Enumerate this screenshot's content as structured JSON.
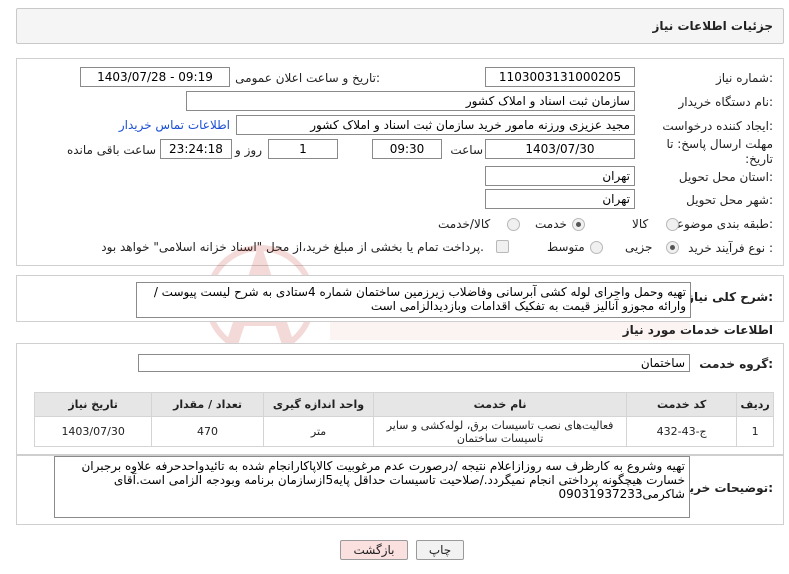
{
  "header": {
    "title": "جزئیات اطلاعات نیاز"
  },
  "form": {
    "need_number_label": "شماره نیاز:",
    "need_number": "1103003131000205",
    "announce_label": "تاریخ و ساعت اعلان عمومی:",
    "announce_value": "1403/07/28 - 09:19",
    "buyer_org_label": "نام دستگاه خریدار:",
    "buyer_org": "سازمان ثبت اسناد و املاک کشور",
    "creator_label": "ایجاد کننده درخواست:",
    "creator": "مجید عزیزی ورزنه مامور خرید سازمان ثبت اسناد و املاک کشور",
    "contact_link": "اطلاعات تماس خریدار",
    "deadline_label": "مهلت ارسال پاسخ: تا تاریخ:",
    "deadline_date": "1403/07/30",
    "time_label": "ساعت",
    "deadline_time": "09:30",
    "days_value": "1",
    "days_label": "روز و",
    "remaining_time": "23:24:18",
    "remaining_label": "ساعت باقی مانده",
    "province_label": "استان محل تحویل:",
    "province": "تهران",
    "city_label": "شهر محل تحویل:",
    "city": "تهران",
    "category_label": "طبقه بندی موضوعی:",
    "category_options": [
      "کالا",
      "خدمت",
      "کالا/خدمت"
    ],
    "category_selected": "خدمت",
    "process_label": "نوع فرآیند خرید :",
    "process_options": [
      "جزیی",
      "متوسط"
    ],
    "process_selected": "جزیی",
    "treasury_text": "پرداخت تمام یا بخشی از مبلغ خرید،از محل \"اسناد خزانه اسلامی\" خواهد بود."
  },
  "summary": {
    "label": "شرح کلی نیاز:",
    "text": "تهیه وحمل واجرای لوله کشی آبرسانی وفاضلاب زیرزمین ساختمان شماره 4ستادی به شرح لیست پیوست / وارائه مجوزو آنالیز قیمت به تفکیک اقدامات وبازدیدالزامی است"
  },
  "services": {
    "section_title": "اطلاعات خدمات مورد نیاز",
    "group_label": "گروه خدمت:",
    "group_value": "ساختمان",
    "columns": [
      "ردیف",
      "کد خدمت",
      "نام خدمت",
      "واحد اندازه گیری",
      "تعداد / مقدار",
      "تاریخ نیاز"
    ],
    "rows": [
      {
        "index": "1",
        "code": "ج-43-432",
        "name": "فعالیت‌های نصب تاسیسات برق، لوله‌کشی و سایر تاسیسات ساختمان",
        "unit": "متر",
        "qty": "470",
        "date": "1403/07/30"
      }
    ]
  },
  "buyer_notes": {
    "label": "توضیحات خریدار:",
    "text": "تهیه وشروع به کارظرف سه روزازاعلام نتیجه /درصورت عدم مرغوبیت کالاپاکارانجام شده به تائیدواحدحرفه علاوه برجبران خسارت هیچگونه پرداختی انجام نمیگردد./صلاحیت تاسیسات حداقل پایه5ازسازمان برنامه وبودجه الزامی است.آقای شاکرمی09031937233"
  },
  "buttons": {
    "print": "چاپ",
    "back": "بازگشت"
  },
  "watermark": {
    "brand": "AriaTender.neT"
  }
}
